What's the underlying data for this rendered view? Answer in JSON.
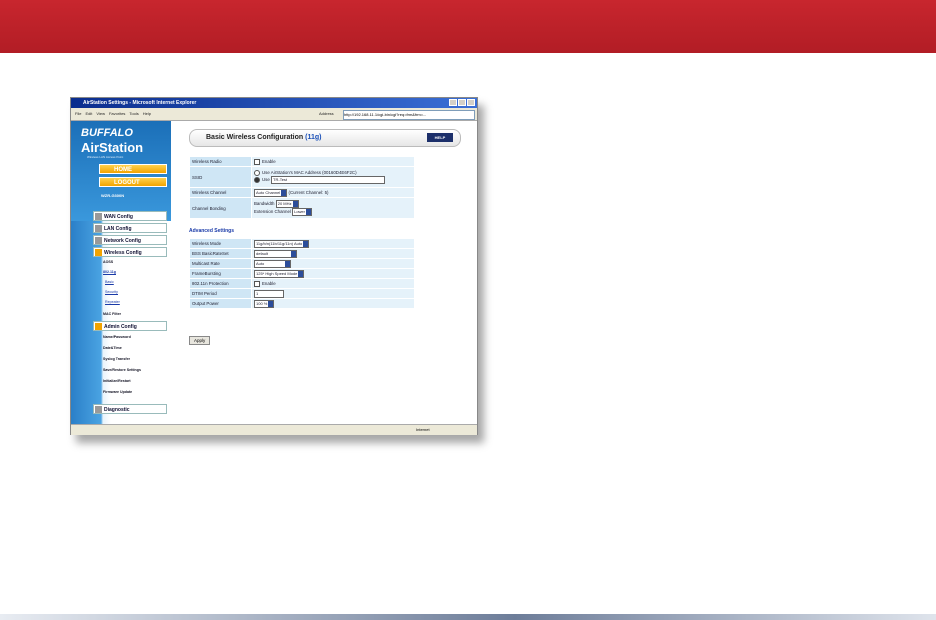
{
  "window": {
    "title": "AirStation Settings - Microsoft Internet Explorer"
  },
  "menubar": {
    "items": [
      "File",
      "Edit",
      "View",
      "Favorites",
      "Tools",
      "Help"
    ],
    "address_label": "Address",
    "address_value": "http://192.168.11.1/cgi-bin/cgi?req=frm&frm=..."
  },
  "sidebar": {
    "brand": "BUFFALO",
    "product": "AirStation",
    "subtitle": "Wireless LAN Access Point",
    "home": "HOME",
    "logout": "LOGOUT",
    "model": "WZR-G300N",
    "menu": [
      {
        "label": "WAN Config"
      },
      {
        "label": "LAN Config"
      },
      {
        "label": "Network Config"
      },
      {
        "label": "Wireless Config"
      },
      {
        "label": "Admin Config"
      },
      {
        "label": "Diagnostic"
      }
    ],
    "wireless_links": [
      "AOSS",
      "802.11g",
      "Basic",
      "Security",
      "Repeater",
      "MAC Filter"
    ],
    "admin_links": [
      "Name/Password",
      "Date&Time",
      "Syslog Transfer",
      "Save/Restore Settings",
      "Initialize/Restart",
      "Firmware Update"
    ]
  },
  "main": {
    "title": "Basic Wireless Configuration",
    "title_accent": "(11g)",
    "help": "HELP",
    "basic": [
      {
        "label": "Wireless Radio",
        "value": "Enable"
      },
      {
        "label": "SSID",
        "value1": "Use AirStation's MAC Address (00160D4E6F2C)",
        "value2": "Use",
        "ssid": "TR-Test"
      },
      {
        "label": "Wireless Channel",
        "value": "Auto Channel",
        "note": "(Current Channel: 5)"
      },
      {
        "label": "Channel Bonding",
        "bandwidth_label": "Bandwidth",
        "bandwidth": "20 MHz",
        "ext_label": "Extension Channel",
        "ext": "Lower"
      }
    ],
    "advanced_heading": "Advanced Settings",
    "advanced": [
      {
        "label": "Wireless Mode",
        "value": "11g/b/n(11b/11g/11n) Auto"
      },
      {
        "label": "BSS BasicRateSet",
        "value": "default"
      },
      {
        "label": "Multicast Rate",
        "value": "Auto"
      },
      {
        "label": "FrameBursting",
        "value": "125* High Speed Mode"
      },
      {
        "label": "802.11n Protection",
        "value": "Enable"
      },
      {
        "label": "DTIM Period",
        "value": "1"
      },
      {
        "label": "Output Power",
        "value": "100 %"
      }
    ],
    "apply": "Apply"
  },
  "statusbar": {
    "zone": "Internet"
  }
}
